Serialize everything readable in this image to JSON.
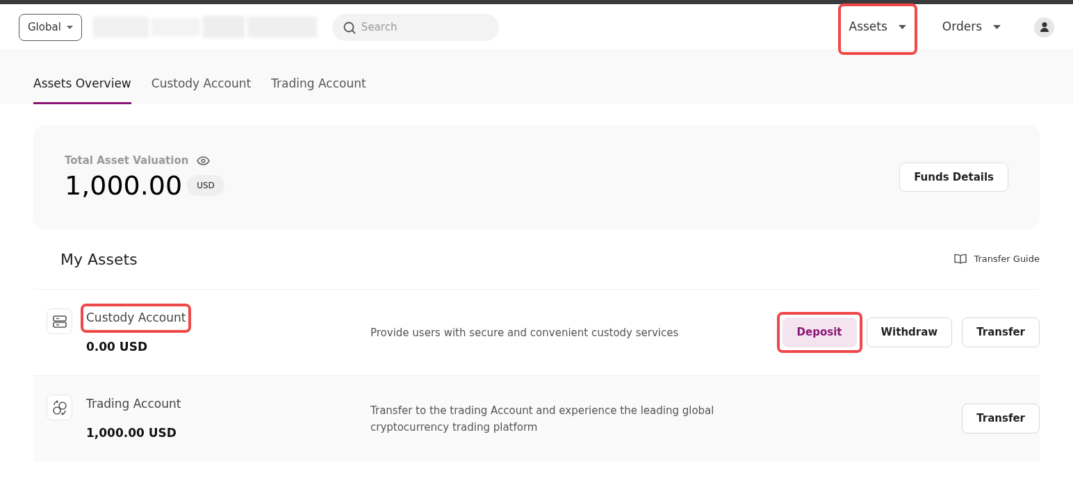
{
  "header": {
    "region": {
      "label": "Global"
    },
    "search": {
      "placeholder": "Search"
    },
    "nav": [
      {
        "label": "Assets",
        "highlighted": true
      },
      {
        "label": "Orders",
        "highlighted": false
      }
    ]
  },
  "tabs": [
    {
      "label": "Assets Overview",
      "selected": true
    },
    {
      "label": "Custody Account",
      "selected": false
    },
    {
      "label": "Trading Account",
      "selected": false
    }
  ],
  "summary": {
    "label": "Total Asset Valuation",
    "value": "1,000.00",
    "currency": "USD",
    "button": "Funds Details"
  },
  "my_assets": {
    "title": "My Assets",
    "guide": "Transfer Guide",
    "accounts": [
      {
        "kind": "custody",
        "name": "Custody Account",
        "name_highlighted": true,
        "balance": "0.00 USD",
        "description": "Provide users with secure and convenient custody services",
        "buttons": [
          {
            "label": "Deposit",
            "kind": "primary",
            "highlighted": true
          },
          {
            "label": "Withdraw",
            "kind": "outline",
            "highlighted": false
          },
          {
            "label": "Transfer",
            "kind": "outline",
            "highlighted": false
          }
        ]
      },
      {
        "kind": "trading",
        "name": "Trading Account",
        "name_highlighted": false,
        "balance": "1,000.00 USD",
        "description": "Transfer to the trading Account and experience the leading global cryptocurrency trading platform",
        "buttons": [
          {
            "label": "Transfer",
            "kind": "outline",
            "highlighted": false
          }
        ]
      }
    ]
  }
}
